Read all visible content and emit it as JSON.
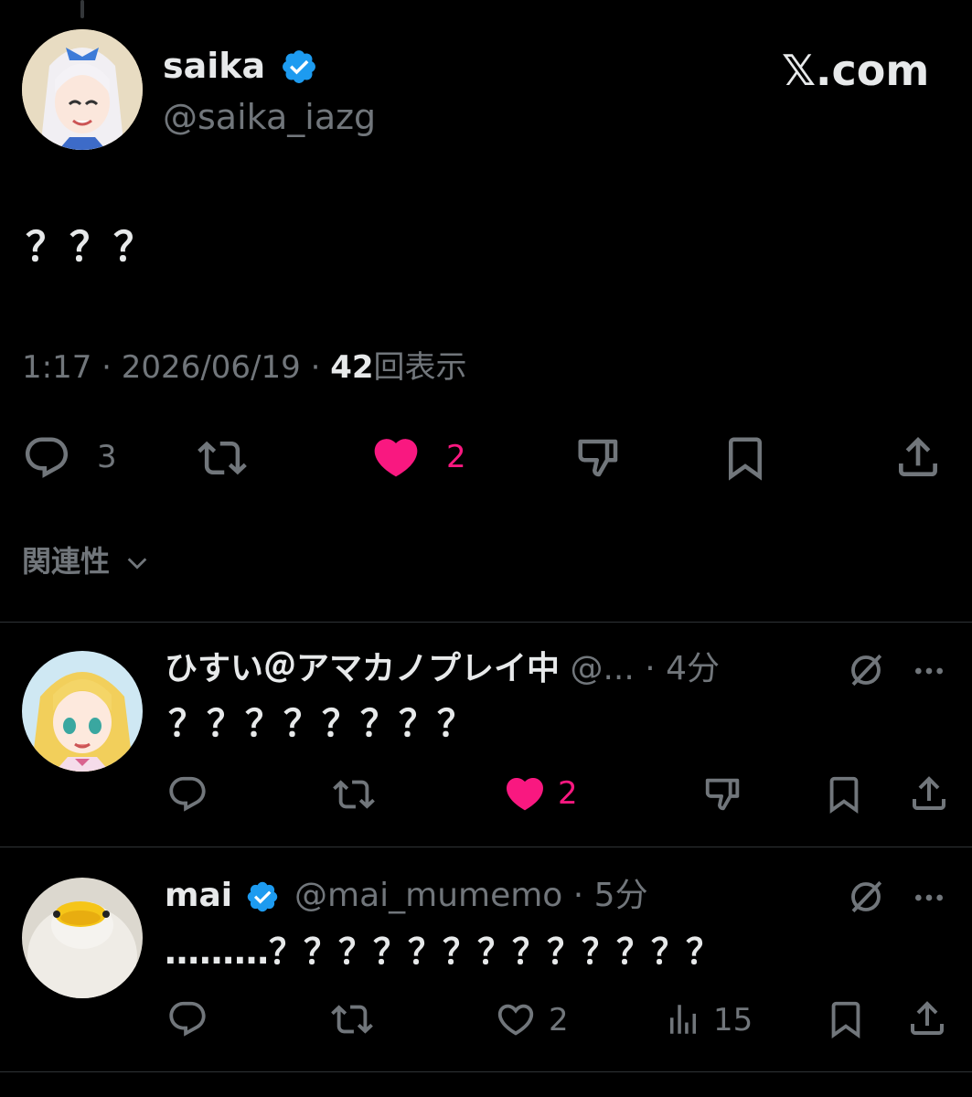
{
  "main_post": {
    "display_name": "saika",
    "handle": "@saika_iazg",
    "brand": "𝕏.com",
    "text": "？？？",
    "time": "1:17",
    "sep1": "·",
    "date": "2026/06/19",
    "sep2": "·",
    "views_count": "42",
    "views_label": "回表示",
    "reply_count": "3",
    "like_count": "2",
    "sort_label": "関連性",
    "colors": {
      "like": "#f91880",
      "verified": "#1d9bf0",
      "muted": "#71767b"
    }
  },
  "replies": [
    {
      "display_name": "ひすい＠アマカノプレイ中",
      "handle": "@...",
      "time": "· 4分",
      "text": "？？？？？？？？",
      "like_count": "2",
      "liked": true
    },
    {
      "display_name": "mai",
      "handle": "@mai_mumemo",
      "time": "· 5分",
      "text": "………？？？？？？？？？？？？？",
      "like_count": "2",
      "views_count": "15",
      "liked": false
    }
  ]
}
